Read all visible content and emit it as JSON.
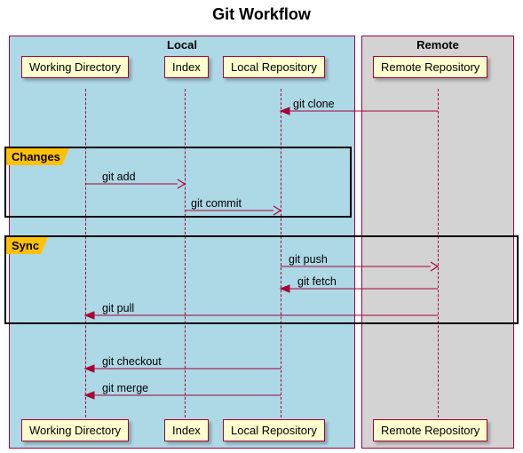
{
  "title": "Git Workflow",
  "groups": {
    "local": {
      "label": "Local"
    },
    "remote": {
      "label": "Remote"
    }
  },
  "participants": {
    "wd": "Working Directory",
    "idx": "Index",
    "lrepo": "Local Repository",
    "rrepo": "Remote Repository"
  },
  "frames": {
    "changes": {
      "label": "Changes"
    },
    "sync": {
      "label": "Sync"
    }
  },
  "messages": {
    "clone": "git clone",
    "add": "git add",
    "commit": "git commit",
    "push": "git push",
    "fetch": "git fetch",
    "pull": "git pull",
    "checkout": "git checkout",
    "merge": "git merge"
  },
  "chart_data": {
    "type": "sequence-diagram",
    "title": "Git Workflow",
    "groups": [
      {
        "name": "Local",
        "participants": [
          "Working Directory",
          "Index",
          "Local Repository"
        ]
      },
      {
        "name": "Remote",
        "participants": [
          "Remote Repository"
        ]
      }
    ],
    "participants": [
      "Working Directory",
      "Index",
      "Local Repository",
      "Remote Repository"
    ],
    "interactions": [
      {
        "from": "Remote Repository",
        "to": "Local Repository",
        "label": "git clone",
        "frame": null
      },
      {
        "from": "Working Directory",
        "to": "Index",
        "label": "git add",
        "frame": "Changes"
      },
      {
        "from": "Index",
        "to": "Local Repository",
        "label": "git commit",
        "frame": "Changes"
      },
      {
        "from": "Local Repository",
        "to": "Remote Repository",
        "label": "git push",
        "frame": "Sync"
      },
      {
        "from": "Remote Repository",
        "to": "Local Repository",
        "label": "git fetch",
        "frame": "Sync"
      },
      {
        "from": "Remote Repository",
        "to": "Working Directory",
        "label": "git pull",
        "frame": "Sync"
      },
      {
        "from": "Local Repository",
        "to": "Working Directory",
        "label": "git checkout",
        "frame": null
      },
      {
        "from": "Local Repository",
        "to": "Working Directory",
        "label": "git merge",
        "frame": null
      }
    ]
  }
}
